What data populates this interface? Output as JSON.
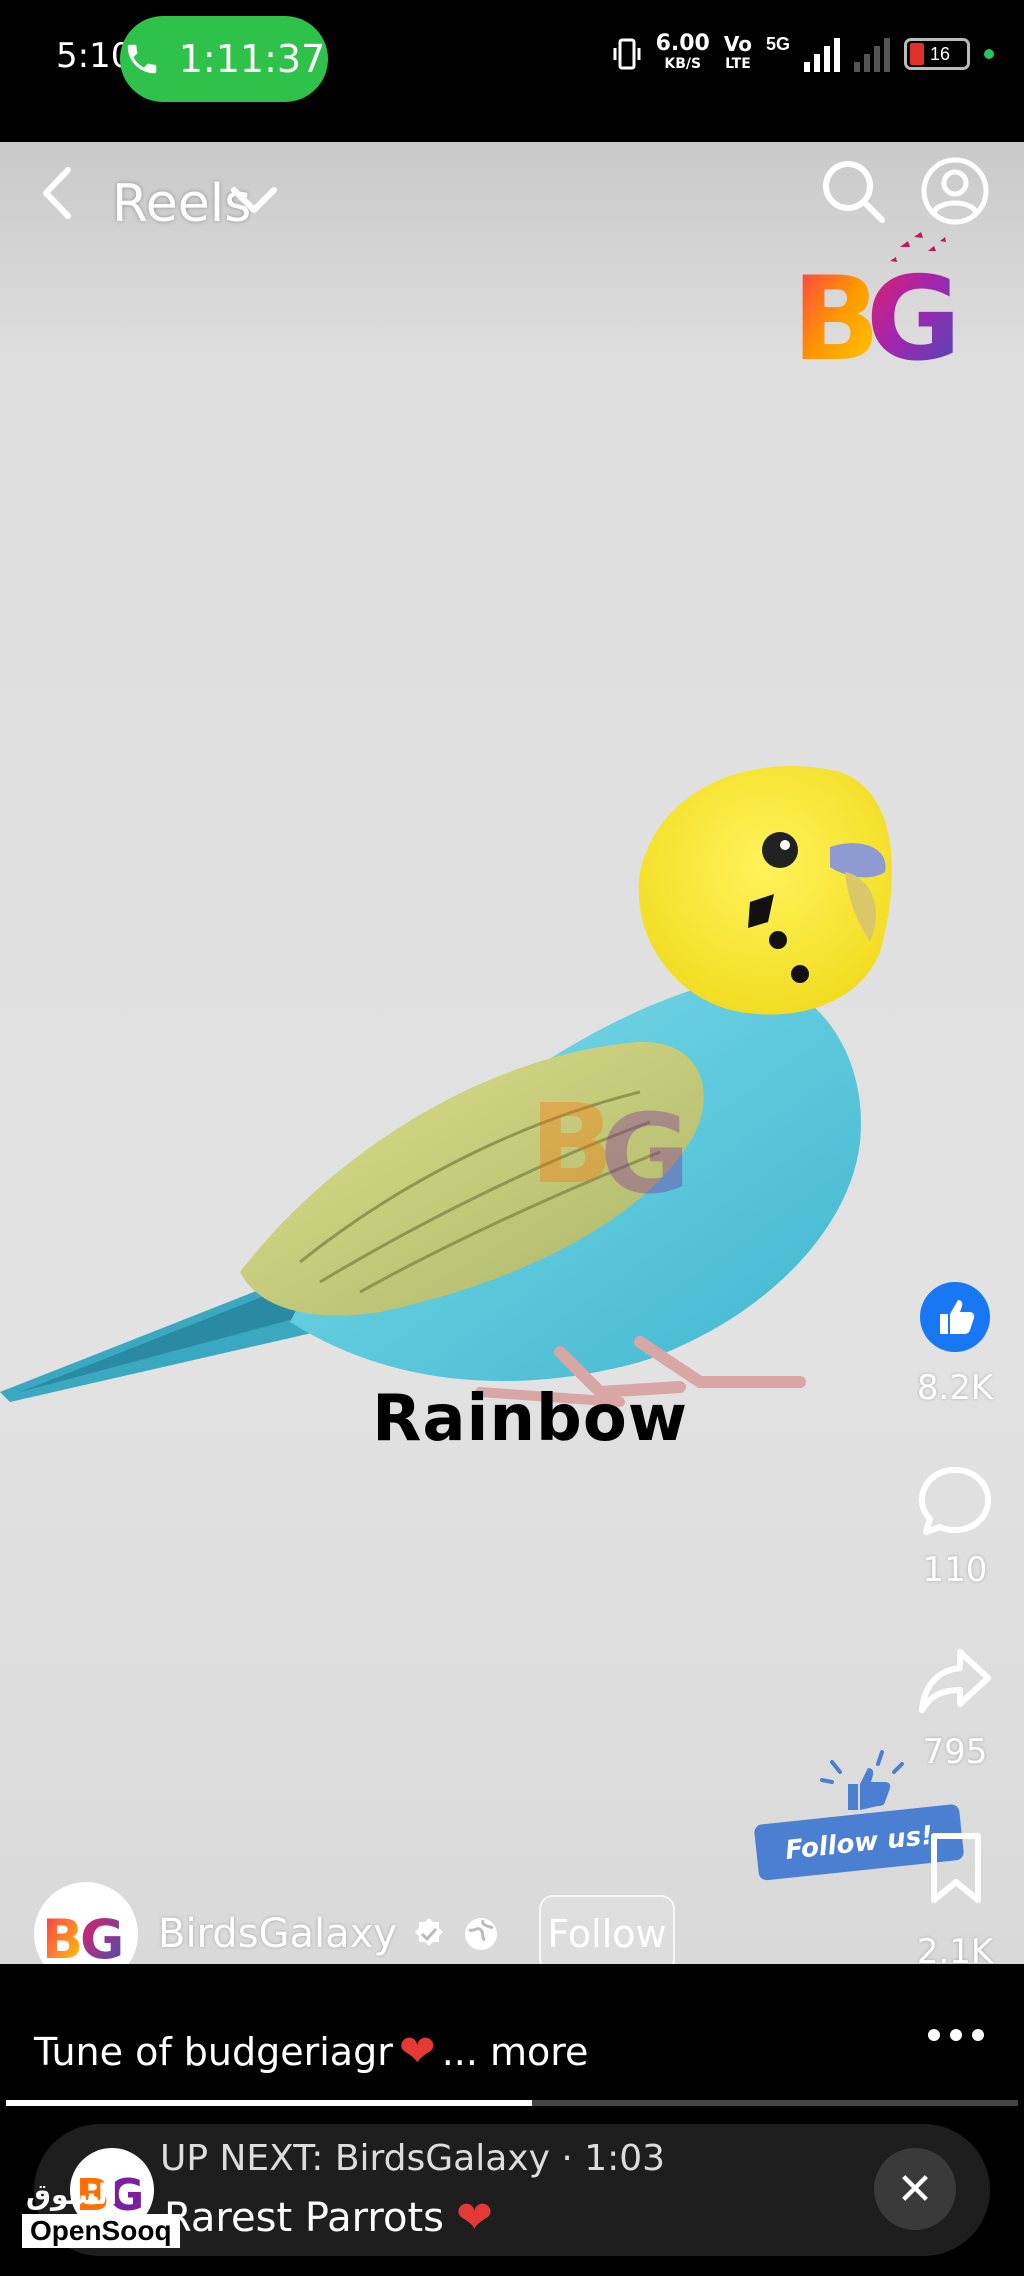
{
  "status_bar": {
    "time": "5:10",
    "call_duration": "1:11:37",
    "net_speed": "6.00",
    "net_speed_unit": "KB/S",
    "volte_top": "Vo",
    "volte_bottom": "LTE",
    "network": "5G",
    "battery": "16"
  },
  "nav": {
    "title": "Reels"
  },
  "logo": {
    "text": "BG"
  },
  "video": {
    "caption": "Rainbow"
  },
  "rail": {
    "likes": "8.2K",
    "comments": "110",
    "shares": "795",
    "saves": "2.1K"
  },
  "sticker": {
    "text": "Follow us!"
  },
  "author": {
    "name": "BirdsGalaxy",
    "follow_label": "Follow"
  },
  "description": {
    "text": "Tune of budgeriagr",
    "more": "... more"
  },
  "playback": {
    "progress": 0.52
  },
  "up_next": {
    "line1": "UP NEXT: BirdsGalaxy · 1:03",
    "title": "Rarest Parrots",
    "close": "✕"
  },
  "watermark": {
    "arabic": "السوق المفتوح",
    "english": "OpenSooq"
  },
  "colors": {
    "call_green": "#2fc24a",
    "like_blue": "#1877f2",
    "heart_red": "#e53935",
    "background_gray": "#e0e0e0"
  },
  "icons": [
    "phone-icon",
    "back-arrow-icon",
    "chevron-down-icon",
    "search-icon",
    "profile-icon",
    "like-icon",
    "comment-icon",
    "share-icon",
    "bookmark-icon",
    "verified-icon",
    "globe-icon",
    "more-icon",
    "close-icon"
  ]
}
